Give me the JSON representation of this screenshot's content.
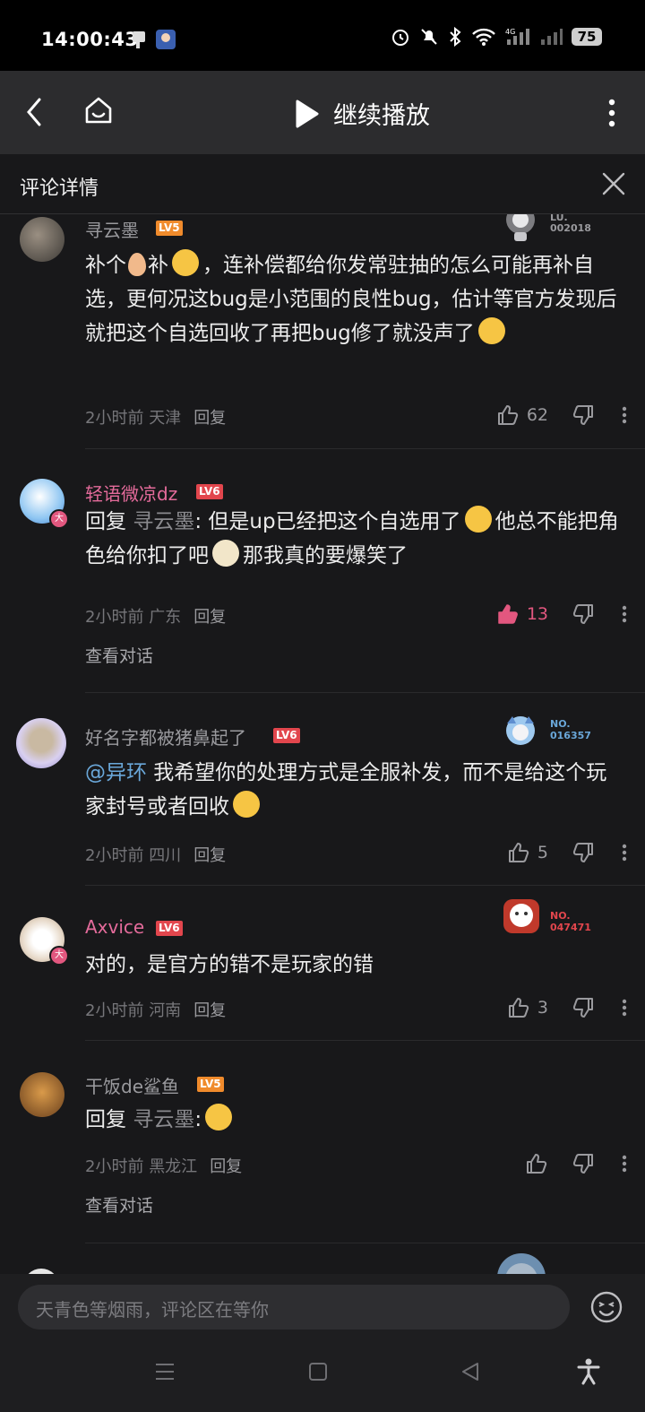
{
  "status": {
    "time": "14:00:43",
    "battery": "75",
    "network": "4G"
  },
  "topbar": {
    "title": "继续播放"
  },
  "subheader": {
    "title": "评论详情"
  },
  "comments": [
    {
      "user": "寻云墨",
      "level": "LV5",
      "level_color": "#f08b2c",
      "name_color": "#9a9a9e",
      "badge_text": "LU.\n002018",
      "body_parts": [
        "补个",
        "补",
        "，连补偿都给你发常驻抽的怎么可能再补自选，更何况这bug是小范围的良性bug，估计等官方发现后就把这个自选回收了再把bug修了就没声了"
      ],
      "time": "2小时前",
      "location": "天津",
      "reply": "回复",
      "likes": "62"
    },
    {
      "user": "轻语微凉dz",
      "level": "LV6",
      "level_color": "#e2464d",
      "name_color": "#e46b9b",
      "body_prefix": "回复 ",
      "reply_to": "寻云墨",
      "body_parts": [
        ": 但是up已经把这个自选用了",
        "他总不能把角色给你扣了吧",
        "那我真的要爆笑了"
      ],
      "time": "2小时前",
      "location": "广东",
      "reply": "回复",
      "likes": "13",
      "view_conversation": "查看对话"
    },
    {
      "user": "好名字都被猪鼻起了",
      "level": "LV6",
      "level_color": "#e2464d",
      "name_color": "#9a9a9e",
      "badge_no": "NO.",
      "badge_num": "016357",
      "mention": "@异环",
      "body_parts": [
        " 我希望你的处理方式是全服补发，而不是给这个玩家封号或者回收"
      ],
      "time": "2小时前",
      "location": "四川",
      "reply": "回复",
      "likes": "5"
    },
    {
      "user": "Axvice",
      "level": "LV6",
      "level_color": "#e2464d",
      "name_color": "#e46b9b",
      "badge_no": "NO.",
      "badge_num": "047471",
      "body_parts": [
        "对的，是官方的错不是玩家的错"
      ],
      "time": "2小时前",
      "location": "河南",
      "reply": "回复",
      "likes": "3"
    },
    {
      "user": "干饭de鲨鱼",
      "level": "LV5",
      "level_color": "#f08b2c",
      "name_color": "#9a9a9e",
      "body_prefix": "回复 ",
      "reply_to": "寻云墨",
      "body_parts": [
        ":"
      ],
      "time": "2小时前",
      "location": "黑龙江",
      "reply": "回复",
      "view_conversation": "查看对话"
    }
  ],
  "composer": {
    "placeholder": "天青色等烟雨，评论区在等你"
  },
  "colors": {
    "background": "#18181a",
    "liked": "#e2577f",
    "mention": "#6aa7d9"
  }
}
